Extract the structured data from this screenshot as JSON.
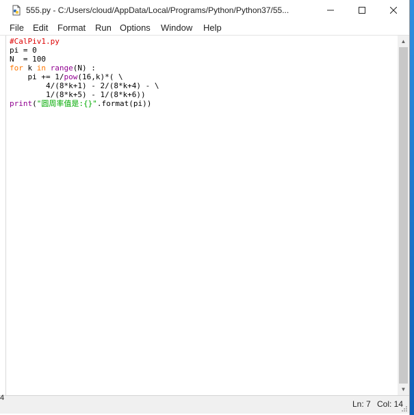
{
  "window": {
    "title": "555.py - C:/Users/cloud/AppData/Local/Programs/Python/Python37/55...",
    "icons": {
      "app": "python-file-icon",
      "minimize": "minimize-icon",
      "maximize": "maximize-icon",
      "close": "close-icon"
    }
  },
  "menu": {
    "items": [
      {
        "label": "File"
      },
      {
        "label": "Edit"
      },
      {
        "label": "Format"
      },
      {
        "label": "Run"
      },
      {
        "label": "Options"
      },
      {
        "label": "Window"
      },
      {
        "label": "Help"
      }
    ]
  },
  "editor": {
    "lines": [
      "#CalPiv1.py",
      "pi = 0",
      "N  = 100",
      "for k in range(N) :",
      "    pi += 1/pow(16,k)*( \\",
      "        4/(8*k+1) - 2/(8*k+4) - \\",
      "        1/(8*k+5) - 1/(8*k+6))",
      "print(\"圆周率值是:{}\".format(pi))"
    ],
    "colors": {
      "comment": "#dd0000",
      "keyword": "#ff7700",
      "builtin": "#900090",
      "string": "#00aa00"
    }
  },
  "status": {
    "line": "Ln: 7",
    "col": "Col: 14",
    "edge_char": "4"
  }
}
